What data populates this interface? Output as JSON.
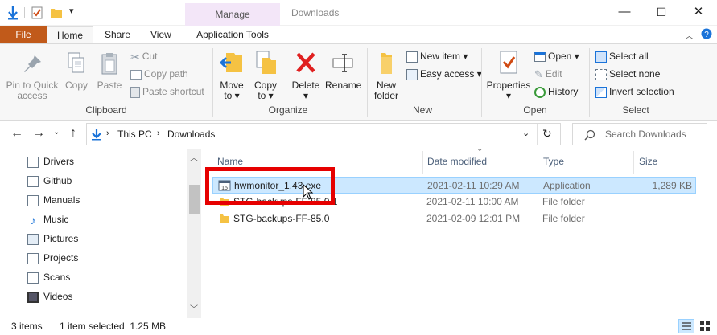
{
  "window": {
    "title": "Downloads",
    "context_tab": "Manage",
    "controls": {
      "minimize": "—",
      "maximize": "☐",
      "close": "✕"
    }
  },
  "tabs": {
    "file": "File",
    "home": "Home",
    "share": "Share",
    "view": "View",
    "app_tools": "Application Tools"
  },
  "ribbon": {
    "clipboard": {
      "label": "Clipboard",
      "pin": "Pin to Quick access",
      "pin_line1": "Pin to Quick",
      "pin_line2": "access",
      "copy": "Copy",
      "paste": "Paste",
      "cut": "Cut",
      "copy_path": "Copy path",
      "paste_shortcut": "Paste shortcut"
    },
    "organize": {
      "label": "Organize",
      "move_to_1": "Move",
      "move_to_2": "to ▾",
      "copy_to_1": "Copy",
      "copy_to_2": "to ▾",
      "delete_1": "Delete",
      "delete_2": "▾",
      "rename": "Rename"
    },
    "new": {
      "label": "New",
      "new_folder_1": "New",
      "new_folder_2": "folder",
      "new_item": "New item ▾",
      "easy_access": "Easy access ▾"
    },
    "open": {
      "label": "Open",
      "properties_1": "Properties",
      "properties_2": "▾",
      "open": "Open ▾",
      "edit": "Edit",
      "history": "History"
    },
    "select": {
      "label": "Select",
      "select_all": "Select all",
      "select_none": "Select none",
      "invert": "Invert selection"
    }
  },
  "address": {
    "segments": [
      "This PC",
      "Downloads"
    ],
    "search_placeholder": "Search Downloads"
  },
  "nav": {
    "items": [
      "Drivers",
      "Github",
      "Manuals",
      "Music",
      "Pictures",
      "Projects",
      "Scans",
      "Videos"
    ]
  },
  "columns": {
    "name": "Name",
    "date": "Date modified",
    "type": "Type",
    "size": "Size"
  },
  "files": [
    {
      "name": "hwmonitor_1.43.exe",
      "date": "2021-02-11 10:29 AM",
      "type": "Application",
      "size": "1,289 KB"
    },
    {
      "name": "STG-backups-FF-85.0.1",
      "date": "2021-02-11 10:00 AM",
      "type": "File folder",
      "size": ""
    },
    {
      "name": "STG-backups-FF-85.0",
      "date": "2021-02-09 12:01 PM",
      "type": "File folder",
      "size": ""
    }
  ],
  "status": {
    "items": "3 items",
    "selected": "1 item selected  1.25 MB"
  },
  "colors": {
    "file_tab": "#c15a1a",
    "manage_ctx": "#f3e6f8",
    "selection": "#cce8ff",
    "highlight_box": "#e60000",
    "accent_blue": "#1a73d9"
  }
}
